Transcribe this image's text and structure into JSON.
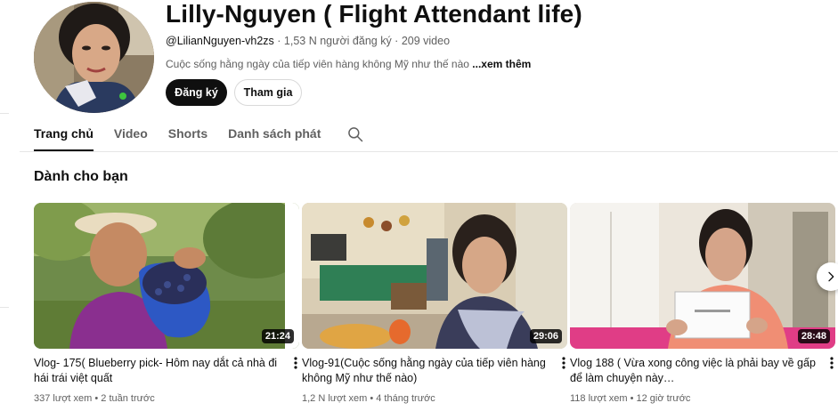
{
  "channel": {
    "title": "Lilly-Nguyen ( Flight Attendant life)",
    "handle": "@LilianNguyen-vh2zs",
    "subscribers": "1,53 N người đăng ký",
    "video_count": "209 video",
    "separator": " · ",
    "description": "Cuộc sống hằng ngày của tiếp viên hàng không Mỹ như thế nào",
    "more_label": "...xem thêm"
  },
  "buttons": {
    "subscribe": "Đăng ký",
    "join": "Tham gia"
  },
  "tabs": [
    {
      "label": "Trang chủ",
      "active": true
    },
    {
      "label": "Video",
      "active": false
    },
    {
      "label": "Shorts",
      "active": false
    },
    {
      "label": "Danh sách phát",
      "active": false
    }
  ],
  "section": {
    "title": "Dành cho bạn"
  },
  "videos": [
    {
      "title": "Vlog- 175( Blueberry pick- Hôm nay dắt cả nhà đi hái trái việt quất",
      "duration": "21:24",
      "views": "337 lượt xem",
      "age": "2 tuần trước"
    },
    {
      "title": "Vlog-91(Cuộc sống hằng ngày của tiếp viên hàng không Mỹ như thế nào)",
      "duration": "29:06",
      "views": "1,2 N lượt xem",
      "age": "4 tháng trước"
    },
    {
      "title": "Vlog 188 ( Vừa xong công việc là phải bay về gấp để làm chuyện này…",
      "duration": "28:48",
      "views": "118 lượt xem",
      "age": "12 giờ trước"
    }
  ],
  "icons": {
    "search": "search-icon",
    "more": "kebab-menu-icon",
    "next": "chevron-right-icon"
  },
  "colors": {
    "text_primary": "#0f0f0f",
    "text_secondary": "#606060",
    "subscribe_bg": "#0f0f0f"
  }
}
